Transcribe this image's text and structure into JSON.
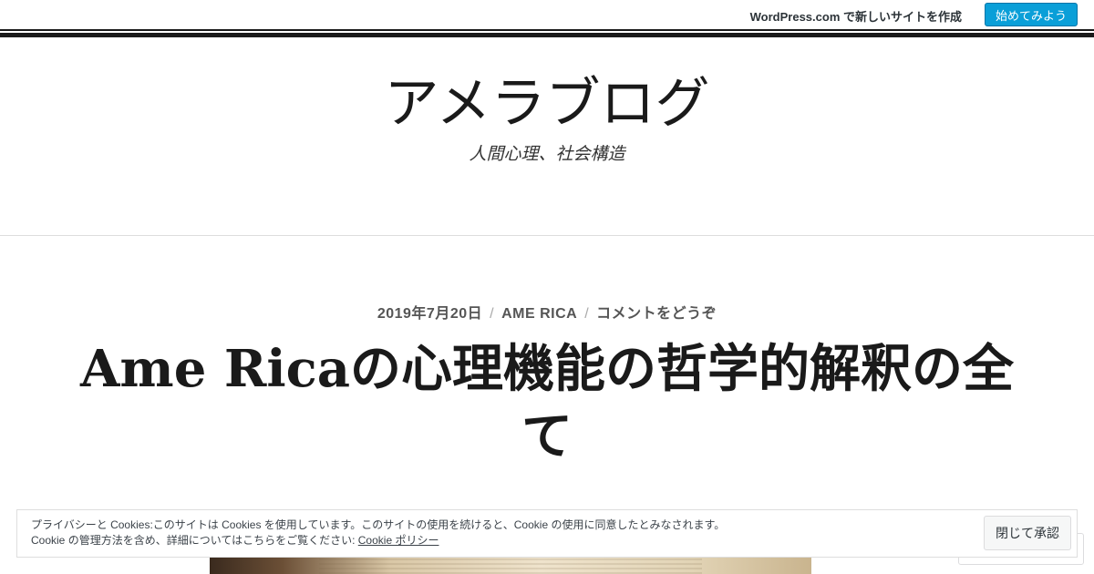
{
  "banner": {
    "text": "WordPress.com で新しいサイトを作成",
    "button": "始めてみよう",
    "button_color": "#0a9fd8"
  },
  "site": {
    "title": "アメラブログ",
    "tagline": "人間心理、社会構造"
  },
  "post": {
    "date": "2019年7月20日",
    "author": "AME RICA",
    "comments": "コメントをどうぞ",
    "separator": "/",
    "title": "Ame Ricaの心理機能の哲学的解釈の全て"
  },
  "cookie": {
    "line1": "プライバシーと Cookies:このサイトは Cookies を使用しています。このサイトの使用を続けると、Cookie の使用に同意したとみなされます。",
    "line2_prefix": "Cookie の管理方法を含め、詳細についてはこちらをご覧ください: ",
    "policy_link": "Cookie ポリシー",
    "close_button": "閉じて承認"
  }
}
